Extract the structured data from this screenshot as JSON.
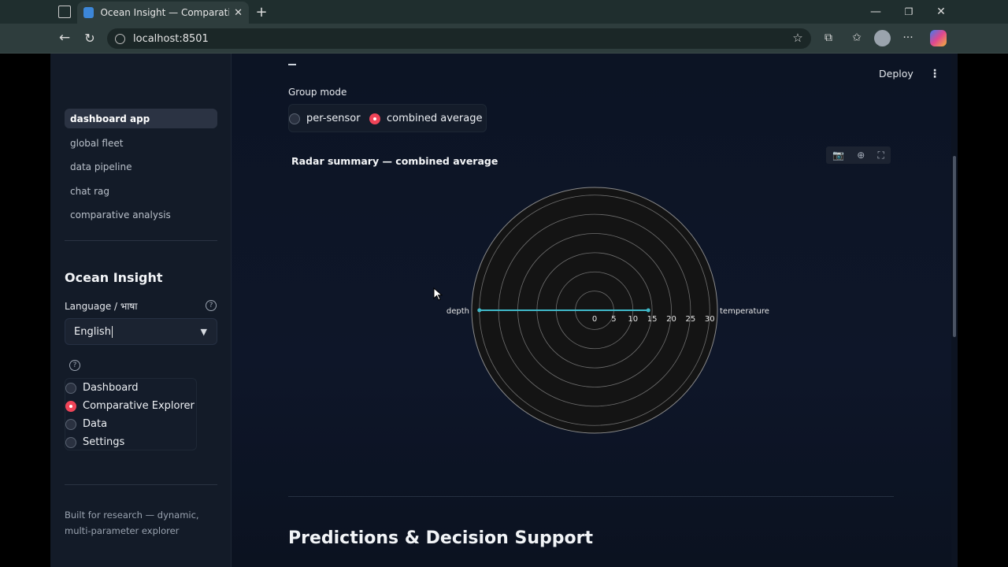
{
  "browser": {
    "tab_title": "Ocean Insight — Comparative Explorer",
    "url": "localhost:8501",
    "icons": [
      "sidebar-toggle-icon",
      "tab-favicon",
      "close-icon",
      "plus-icon",
      "minimize-icon",
      "restore-icon",
      "window-close-icon",
      "back-icon",
      "reload-icon",
      "info-icon",
      "star-icon",
      "extensions-icon",
      "favorites-icon",
      "profile-icon",
      "more-icon",
      "copilot-icon"
    ]
  },
  "sidebar": {
    "nav": [
      {
        "label": "dashboard app",
        "active": true
      },
      {
        "label": "global fleet",
        "active": false
      },
      {
        "label": "data pipeline",
        "active": false
      },
      {
        "label": "chat rag",
        "active": false
      },
      {
        "label": "comparative analysis",
        "active": false
      }
    ],
    "app_title": "Ocean Insight",
    "language_label": "Language / भाषा",
    "language_value": "English",
    "page_options": [
      {
        "label": "Dashboard",
        "selected": false
      },
      {
        "label": "Comparative Explorer",
        "selected": true
      },
      {
        "label": "Data",
        "selected": false
      },
      {
        "label": "Settings",
        "selected": false
      }
    ],
    "footer": "Built for research — dynamic, multi-parameter explorer"
  },
  "header": {
    "deploy_label": "Deploy",
    "menu_icon": "kebab-icon"
  },
  "main": {
    "group_mode_label": "Group mode",
    "group_mode_options": [
      {
        "label": "per-sensor",
        "selected": false
      },
      {
        "label": "combined average",
        "selected": true
      }
    ],
    "section_title": "Predictions & Decision Support",
    "modebar_icons": [
      "camera-icon",
      "zoom-icon",
      "fullscreen-icon"
    ]
  },
  "chart_data": {
    "type": "radar",
    "title": "Radar summary — combined average",
    "theta": [
      "temperature",
      "depth"
    ],
    "series": [
      {
        "values": [
          14,
          30
        ]
      }
    ],
    "radial_ticks": [
      0,
      5,
      10,
      15,
      20,
      25,
      30
    ],
    "radial_range": [
      0,
      32
    ],
    "line_color": "#3fb8c8",
    "grid": true
  }
}
